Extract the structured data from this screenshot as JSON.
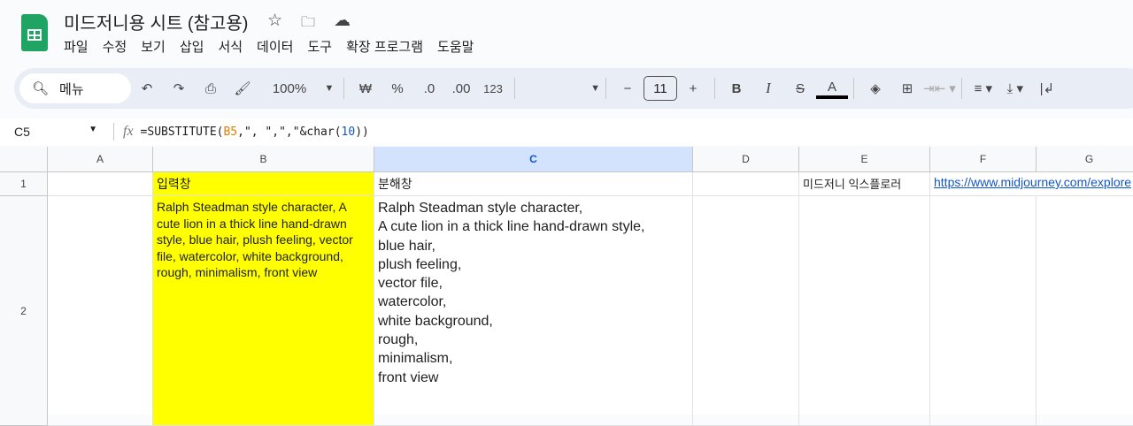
{
  "doc_title": "미드저니용 시트 (참고용)",
  "menu": [
    "파일",
    "수정",
    "보기",
    "삽입",
    "서식",
    "데이터",
    "도구",
    "확장 프로그램",
    "도움말"
  ],
  "toolbar": {
    "search": "메뉴",
    "zoom": "100%",
    "currency": "₩",
    "percent": "%",
    "dec_decrease": ".0",
    "dec_increase": ".00",
    "number_format": "123",
    "font_size": "11"
  },
  "formula_bar": {
    "cell_ref": "C5",
    "formula_prefix": "=SUBSTITUTE(",
    "formula_ref": "B5",
    "formula_mid": ",\", \",\",\"&char(",
    "formula_num": "10",
    "formula_end": "))"
  },
  "columns": [
    "A",
    "B",
    "C",
    "D",
    "E",
    "F",
    "G"
  ],
  "rows": [
    "1",
    "2"
  ],
  "cells": {
    "B1": "입력창",
    "C1": "분해창",
    "E1": "미드저니 익스플로러",
    "F1": "https://www.midjourney.com/explore",
    "B2": "Ralph Steadman style character, A cute lion in a thick line hand-drawn style, blue hair, plush feeling, vector file, watercolor, white background, rough, minimalism, front view",
    "C2": "Ralph Steadman style character,\nA cute lion in a thick line hand-drawn style,\nblue hair,\nplush feeling,\nvector file,\nwatercolor,\nwhite background,\nrough,\nminimalism,\nfront view"
  }
}
